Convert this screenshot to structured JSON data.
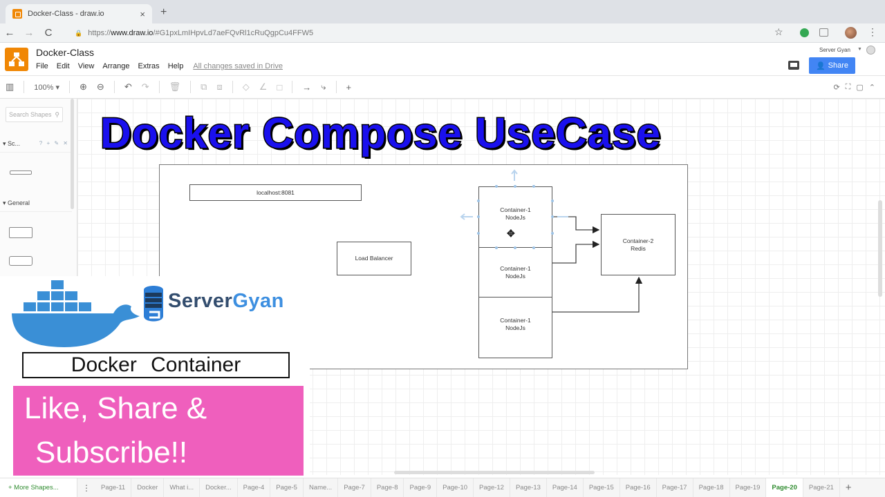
{
  "browser": {
    "tab_title": "Docker-Class - draw.io",
    "tab_close": "×",
    "new_tab": "+",
    "url_scheme": "https://",
    "url_host": "www.draw.io",
    "url_path": "/#G1pxLmIHpvLd7aeFQvRl1cRuQgpCu4FFW5",
    "nav": {
      "back": "←",
      "forward": "→",
      "reload": "C"
    },
    "star": "☆",
    "menu": "⋮"
  },
  "app": {
    "doc_title": "Docker-Class",
    "menu": [
      "File",
      "Edit",
      "View",
      "Arrange",
      "Extras",
      "Help"
    ],
    "save_status": "All changes saved in Drive",
    "user_name": "Server Gyan",
    "share_label": "Share",
    "brand_color": "#f08705",
    "share_color": "#4285f4"
  },
  "toolbar": {
    "zoom": "100%",
    "icons": {
      "format_panel": "▥",
      "dropdown": "▾",
      "zoom_in": "⊕",
      "zoom_out": "⊖",
      "undo": "↶",
      "redo": "↷",
      "delete": "🗑",
      "to_front": "⧉",
      "to_back": "⧈",
      "fill": "◇",
      "line_color": "∠",
      "shadow": "□",
      "connection": "→",
      "waypoints": "⤷",
      "insert": "+"
    },
    "right_icons": [
      "⟳",
      "⛶",
      "▢",
      "⌃"
    ]
  },
  "sidebar": {
    "search_placeholder": "Search Shapes",
    "search_icon": "⚲",
    "scratchpad_label": "▾ Sc...",
    "scratchpad_actions": "? + ✎ ✕",
    "general_label": "▾ General"
  },
  "diagram": {
    "title_overlay": "Docker Compose UseCase",
    "nodes": {
      "localhost": "localhost:8081",
      "load_balancer": "Load Balancer",
      "container1a_line1": "Container-1",
      "container1a_line2": "NodeJs",
      "container1b_line1": "Container-1",
      "container1b_line2": "NodeJs",
      "container1c_line1": "Container-1",
      "container1c_line2": "NodeJs",
      "container2_line1": "Container-2",
      "container2_line2": "Redis"
    },
    "title_color": "#1a10ee"
  },
  "overlay": {
    "brand_server": "Server",
    "brand_gyan": "Gyan",
    "docker_container": "Docker Container",
    "subscribe_line1": "Like, Share &",
    "subscribe_line2": "Subscribe!!",
    "subscribe_color": "#ef5fbd",
    "docker_blue": "#3a8fd6"
  },
  "pages": {
    "more_shapes": "+ More Shapes...",
    "menu_icon": "⋮",
    "tabs": [
      "Page-11",
      "Docker",
      "What i...",
      "Docker...",
      "Page-4",
      "Page-5",
      "Name...",
      "Page-7",
      "Page-8",
      "Page-9",
      "Page-10",
      "Page-12",
      "Page-13",
      "Page-14",
      "Page-15",
      "Page-16",
      "Page-17",
      "Page-18",
      "Page-19",
      "Page-20",
      "Page-21"
    ],
    "active": "Page-20",
    "add": "+"
  }
}
